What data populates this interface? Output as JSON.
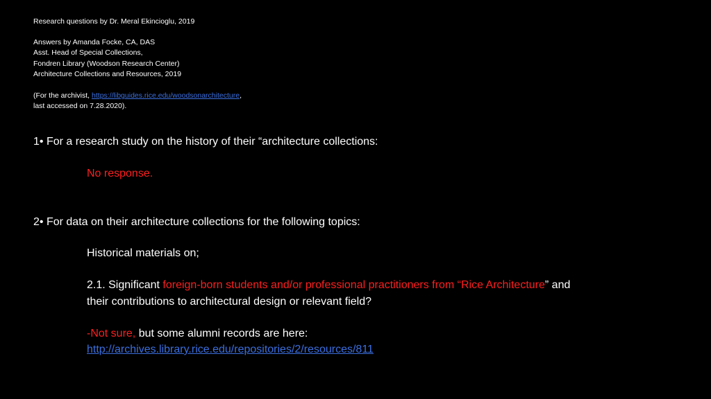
{
  "header": {
    "line1": "Research questions by Dr. Meral Ekincioglu, 2019",
    "line2": "Answers by Amanda Focke, CA, DAS",
    "line3": "Asst. Head of Special Collections,",
    "line4": "Fondren Library (Woodson Research Center)",
    "line5": "Architecture Collections and Resources, 2019",
    "line6_pre": "(For the archivist, ",
    "line6_link": "https://libguides.rice.edu/woodsonarchitecture",
    "line6_post": ",",
    "line7": "last accessed on 7.28.2020)."
  },
  "q1": {
    "text": "1• For a  research study on the history of their “architecture collections:",
    "answer": "No response."
  },
  "q2": {
    "text": "2• For data on their architecture collections for the following topics:",
    "sub": "Historical materials on;",
    "item_pre": "2.1. Significant ",
    "item_red": "foreign-born students and/or professional practitioners from “Rice Architecture",
    "item_post": "” and",
    "item_line2": " their contributions to architectural design or relevant field?",
    "answer_red": "-Not sure, ",
    "answer_rest": "but some alumni records are here:",
    "answer_link": " http://archives.library.rice.edu/repositories/2/resources/811"
  },
  "colors": {
    "background": "#000000",
    "text": "#ffffff",
    "accent_red": "#ff1f1f",
    "link": "#3b6fe0"
  }
}
